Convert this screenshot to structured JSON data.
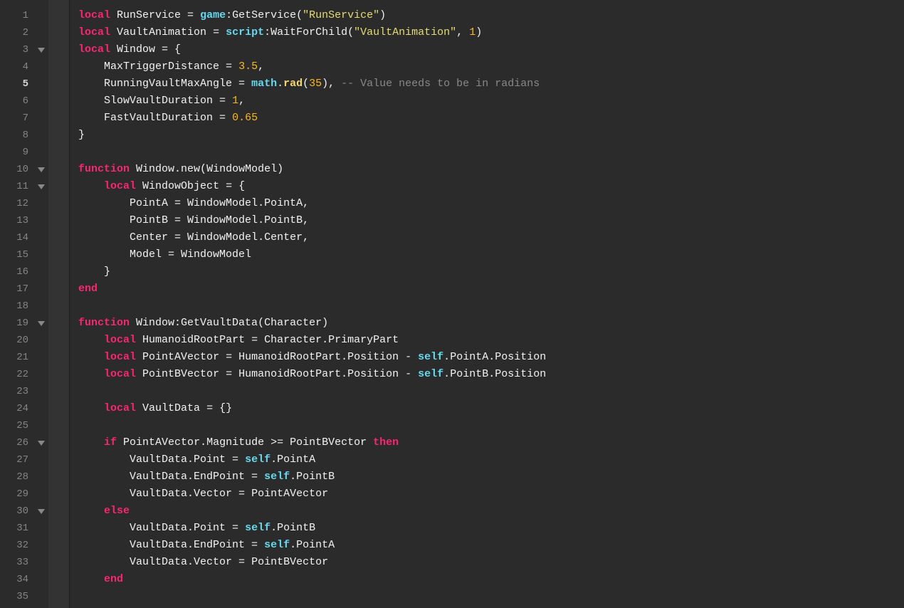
{
  "currentLine": 5,
  "lines": [
    {
      "n": 1,
      "fold": false,
      "tokens": [
        [
          "kw",
          "local"
        ],
        [
          "pn",
          " "
        ],
        [
          "id",
          "RunService"
        ],
        [
          "pn",
          " = "
        ],
        [
          "glb",
          "game"
        ],
        [
          "pn",
          ":"
        ],
        [
          "id",
          "GetService"
        ],
        [
          "pn",
          "("
        ],
        [
          "str",
          "\"RunService\""
        ],
        [
          "pn",
          ")"
        ]
      ]
    },
    {
      "n": 2,
      "fold": false,
      "tokens": [
        [
          "kw",
          "local"
        ],
        [
          "pn",
          " "
        ],
        [
          "id",
          "VaultAnimation"
        ],
        [
          "pn",
          " = "
        ],
        [
          "glb",
          "script"
        ],
        [
          "pn",
          ":"
        ],
        [
          "id",
          "WaitForChild"
        ],
        [
          "pn",
          "("
        ],
        [
          "str",
          "\"VaultAnimation\""
        ],
        [
          "pn",
          ", "
        ],
        [
          "num",
          "1"
        ],
        [
          "pn",
          ")"
        ]
      ]
    },
    {
      "n": 3,
      "fold": true,
      "tokens": [
        [
          "kw",
          "local"
        ],
        [
          "pn",
          " "
        ],
        [
          "id",
          "Window"
        ],
        [
          "pn",
          " = {"
        ]
      ]
    },
    {
      "n": 4,
      "fold": false,
      "tokens": [
        [
          "pn",
          "    "
        ],
        [
          "id",
          "MaxTriggerDistance"
        ],
        [
          "pn",
          " = "
        ],
        [
          "num",
          "3.5"
        ],
        [
          "pn",
          ","
        ]
      ]
    },
    {
      "n": 5,
      "fold": false,
      "tokens": [
        [
          "pn",
          "    "
        ],
        [
          "id",
          "RunningVaultMaxAngle"
        ],
        [
          "pn",
          " = "
        ],
        [
          "glb",
          "math"
        ],
        [
          "pn",
          "."
        ],
        [
          "radf",
          "rad"
        ],
        [
          "pn",
          "("
        ],
        [
          "num",
          "35"
        ],
        [
          "pn",
          "), "
        ],
        [
          "cmt",
          "-- Value needs to be in radians"
        ]
      ]
    },
    {
      "n": 6,
      "fold": false,
      "tokens": [
        [
          "pn",
          "    "
        ],
        [
          "id",
          "SlowVaultDuration"
        ],
        [
          "pn",
          " = "
        ],
        [
          "num",
          "1"
        ],
        [
          "pn",
          ","
        ]
      ]
    },
    {
      "n": 7,
      "fold": false,
      "tokens": [
        [
          "pn",
          "    "
        ],
        [
          "id",
          "FastVaultDuration"
        ],
        [
          "pn",
          " = "
        ],
        [
          "num",
          "0.65"
        ]
      ]
    },
    {
      "n": 8,
      "fold": false,
      "tokens": [
        [
          "pn",
          "}"
        ]
      ]
    },
    {
      "n": 9,
      "fold": false,
      "tokens": []
    },
    {
      "n": 10,
      "fold": true,
      "tokens": [
        [
          "kw",
          "function"
        ],
        [
          "pn",
          " "
        ],
        [
          "id",
          "Window.new"
        ],
        [
          "pn",
          "("
        ],
        [
          "id",
          "WindowModel"
        ],
        [
          "pn",
          ")"
        ]
      ]
    },
    {
      "n": 11,
      "fold": true,
      "tokens": [
        [
          "pn",
          "    "
        ],
        [
          "kw",
          "local"
        ],
        [
          "pn",
          " "
        ],
        [
          "id",
          "WindowObject"
        ],
        [
          "pn",
          " = {"
        ]
      ]
    },
    {
      "n": 12,
      "fold": false,
      "tokens": [
        [
          "pn",
          "        "
        ],
        [
          "id",
          "PointA"
        ],
        [
          "pn",
          " = "
        ],
        [
          "id",
          "WindowModel.PointA"
        ],
        [
          "pn",
          ","
        ]
      ]
    },
    {
      "n": 13,
      "fold": false,
      "tokens": [
        [
          "pn",
          "        "
        ],
        [
          "id",
          "PointB"
        ],
        [
          "pn",
          " = "
        ],
        [
          "id",
          "WindowModel.PointB"
        ],
        [
          "pn",
          ","
        ]
      ]
    },
    {
      "n": 14,
      "fold": false,
      "tokens": [
        [
          "pn",
          "        "
        ],
        [
          "id",
          "Center"
        ],
        [
          "pn",
          " = "
        ],
        [
          "id",
          "WindowModel.Center"
        ],
        [
          "pn",
          ","
        ]
      ]
    },
    {
      "n": 15,
      "fold": false,
      "tokens": [
        [
          "pn",
          "        "
        ],
        [
          "id",
          "Model"
        ],
        [
          "pn",
          " = "
        ],
        [
          "id",
          "WindowModel"
        ]
      ]
    },
    {
      "n": 16,
      "fold": false,
      "tokens": [
        [
          "pn",
          "    }"
        ]
      ]
    },
    {
      "n": 17,
      "fold": false,
      "tokens": [
        [
          "kw",
          "end"
        ]
      ]
    },
    {
      "n": 18,
      "fold": false,
      "tokens": []
    },
    {
      "n": 19,
      "fold": true,
      "tokens": [
        [
          "kw",
          "function"
        ],
        [
          "pn",
          " "
        ],
        [
          "id",
          "Window:GetVaultData"
        ],
        [
          "pn",
          "("
        ],
        [
          "id",
          "Character"
        ],
        [
          "pn",
          ")"
        ]
      ]
    },
    {
      "n": 20,
      "fold": false,
      "tokens": [
        [
          "pn",
          "    "
        ],
        [
          "kw",
          "local"
        ],
        [
          "pn",
          " "
        ],
        [
          "id",
          "HumanoidRootPart"
        ],
        [
          "pn",
          " = "
        ],
        [
          "id",
          "Character.PrimaryPart"
        ]
      ]
    },
    {
      "n": 21,
      "fold": false,
      "tokens": [
        [
          "pn",
          "    "
        ],
        [
          "kw",
          "local"
        ],
        [
          "pn",
          " "
        ],
        [
          "id",
          "PointAVector"
        ],
        [
          "pn",
          " = "
        ],
        [
          "id",
          "HumanoidRootPart.Position"
        ],
        [
          "pn",
          " - "
        ],
        [
          "glb",
          "self"
        ],
        [
          "pn",
          "."
        ],
        [
          "id",
          "PointA.Position"
        ]
      ]
    },
    {
      "n": 22,
      "fold": false,
      "tokens": [
        [
          "pn",
          "    "
        ],
        [
          "kw",
          "local"
        ],
        [
          "pn",
          " "
        ],
        [
          "id",
          "PointBVector"
        ],
        [
          "pn",
          " = "
        ],
        [
          "id",
          "HumanoidRootPart.Position"
        ],
        [
          "pn",
          " - "
        ],
        [
          "glb",
          "self"
        ],
        [
          "pn",
          "."
        ],
        [
          "id",
          "PointB.Position"
        ]
      ]
    },
    {
      "n": 23,
      "fold": false,
      "tokens": []
    },
    {
      "n": 24,
      "fold": false,
      "tokens": [
        [
          "pn",
          "    "
        ],
        [
          "kw",
          "local"
        ],
        [
          "pn",
          " "
        ],
        [
          "id",
          "VaultData"
        ],
        [
          "pn",
          " = {}"
        ]
      ]
    },
    {
      "n": 25,
      "fold": false,
      "tokens": []
    },
    {
      "n": 26,
      "fold": true,
      "tokens": [
        [
          "pn",
          "    "
        ],
        [
          "kw",
          "if"
        ],
        [
          "pn",
          " "
        ],
        [
          "id",
          "PointAVector.Magnitude"
        ],
        [
          "pn",
          " >= "
        ],
        [
          "id",
          "PointBVector"
        ],
        [
          "pn",
          " "
        ],
        [
          "kw",
          "then"
        ]
      ]
    },
    {
      "n": 27,
      "fold": false,
      "tokens": [
        [
          "pn",
          "        "
        ],
        [
          "id",
          "VaultData.Point"
        ],
        [
          "pn",
          " = "
        ],
        [
          "glb",
          "self"
        ],
        [
          "pn",
          "."
        ],
        [
          "id",
          "PointA"
        ]
      ]
    },
    {
      "n": 28,
      "fold": false,
      "tokens": [
        [
          "pn",
          "        "
        ],
        [
          "id",
          "VaultData.EndPoint"
        ],
        [
          "pn",
          " = "
        ],
        [
          "glb",
          "self"
        ],
        [
          "pn",
          "."
        ],
        [
          "id",
          "PointB"
        ]
      ]
    },
    {
      "n": 29,
      "fold": false,
      "tokens": [
        [
          "pn",
          "        "
        ],
        [
          "id",
          "VaultData.Vector"
        ],
        [
          "pn",
          " = "
        ],
        [
          "id",
          "PointAVector"
        ]
      ]
    },
    {
      "n": 30,
      "fold": true,
      "tokens": [
        [
          "pn",
          "    "
        ],
        [
          "kw",
          "else"
        ]
      ]
    },
    {
      "n": 31,
      "fold": false,
      "tokens": [
        [
          "pn",
          "        "
        ],
        [
          "id",
          "VaultData.Point"
        ],
        [
          "pn",
          " = "
        ],
        [
          "glb",
          "self"
        ],
        [
          "pn",
          "."
        ],
        [
          "id",
          "PointB"
        ]
      ]
    },
    {
      "n": 32,
      "fold": false,
      "tokens": [
        [
          "pn",
          "        "
        ],
        [
          "id",
          "VaultData.EndPoint"
        ],
        [
          "pn",
          " = "
        ],
        [
          "glb",
          "self"
        ],
        [
          "pn",
          "."
        ],
        [
          "id",
          "PointA"
        ]
      ]
    },
    {
      "n": 33,
      "fold": false,
      "tokens": [
        [
          "pn",
          "        "
        ],
        [
          "id",
          "VaultData.Vector"
        ],
        [
          "pn",
          " = "
        ],
        [
          "id",
          "PointBVector"
        ]
      ]
    },
    {
      "n": 34,
      "fold": false,
      "tokens": [
        [
          "pn",
          "    "
        ],
        [
          "kw",
          "end"
        ]
      ]
    },
    {
      "n": 35,
      "fold": false,
      "tokens": []
    }
  ]
}
